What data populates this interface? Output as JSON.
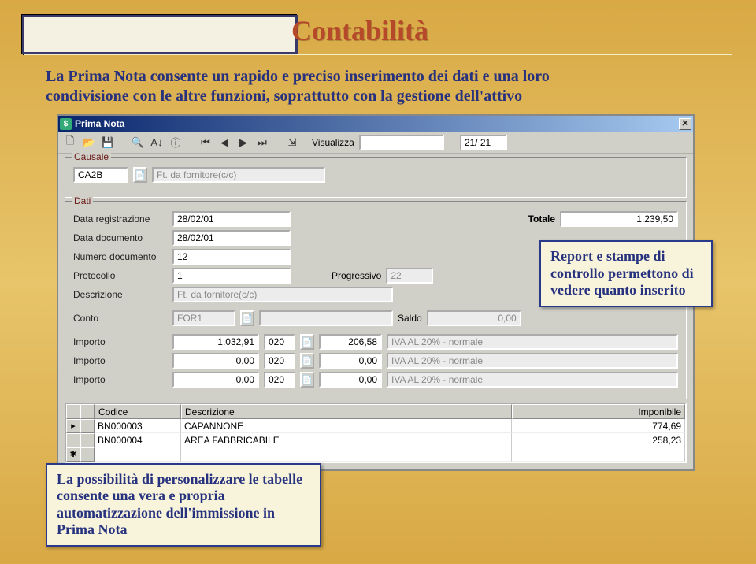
{
  "slide": {
    "title": "Contabilità",
    "intro_line1": "La Prima Nota consente un rapido e preciso inserimento dei dati e una loro",
    "intro_line2": "condivisione con le altre funzioni, soprattutto con la gestione dell'attivo"
  },
  "window": {
    "title": "Prima Nota",
    "visualizza_label": "Visualizza",
    "visualizza_value": "",
    "counter": "21/ 21"
  },
  "toolbar_icons": {
    "new": "🗋",
    "open": "📂",
    "save": "💾",
    "find": "🔍",
    "sort": "A↓",
    "info": "ⓘ",
    "first": "⏮",
    "prev": "◀",
    "next": "▶",
    "last": "⏭",
    "exit": "⇲"
  },
  "causale": {
    "legend": "Causale",
    "code": "CA2B",
    "desc": "Ft. da fornitore(c/c)"
  },
  "dati": {
    "legend": "Dati",
    "labels": {
      "data_reg": "Data registrazione",
      "data_doc": "Data documento",
      "num_doc": "Numero documento",
      "protocollo": "Protocollo",
      "descrizione": "Descrizione",
      "conto": "Conto",
      "importo": "Importo",
      "totale": "Totale",
      "progressivo": "Progressivo",
      "saldo": "Saldo"
    },
    "data_reg": "28/02/01",
    "data_doc": "28/02/01",
    "num_doc": "12",
    "protocollo": "1",
    "progressivo": "22",
    "descrizione": "Ft. da fornitore(c/c)",
    "totale": "1.239,50",
    "conto_code": "FOR1",
    "conto_desc": "",
    "saldo": "0,00",
    "rows": [
      {
        "importo": "1.032,91",
        "cod": "020",
        "val": "206,58",
        "iva": "IVA AL 20% - normale"
      },
      {
        "importo": "0,00",
        "cod": "020",
        "val": "0,00",
        "iva": "IVA AL 20% - normale"
      },
      {
        "importo": "0,00",
        "cod": "020",
        "val": "0,00",
        "iva": "IVA AL 20% - normale"
      }
    ]
  },
  "grid": {
    "headers": {
      "codice": "Codice",
      "descrizione": "Descrizione",
      "imponibile": "Imponibile"
    },
    "rows": [
      {
        "codice": "BN000003",
        "descrizione": "CAPANNONE",
        "imponibile": "774,69"
      },
      {
        "codice": "BN000004",
        "descrizione": "AREA FABBRICABILE",
        "imponibile": "258,23"
      }
    ],
    "markers": {
      "current": "▸",
      "new": "✱"
    }
  },
  "callouts": {
    "right": "Report e stampe di controllo permettono di vedere quanto inserito",
    "left": "La possibilità di personalizzare le tabelle consente una vera e propria automatizzazione dell'immissione in Prima Nota"
  }
}
